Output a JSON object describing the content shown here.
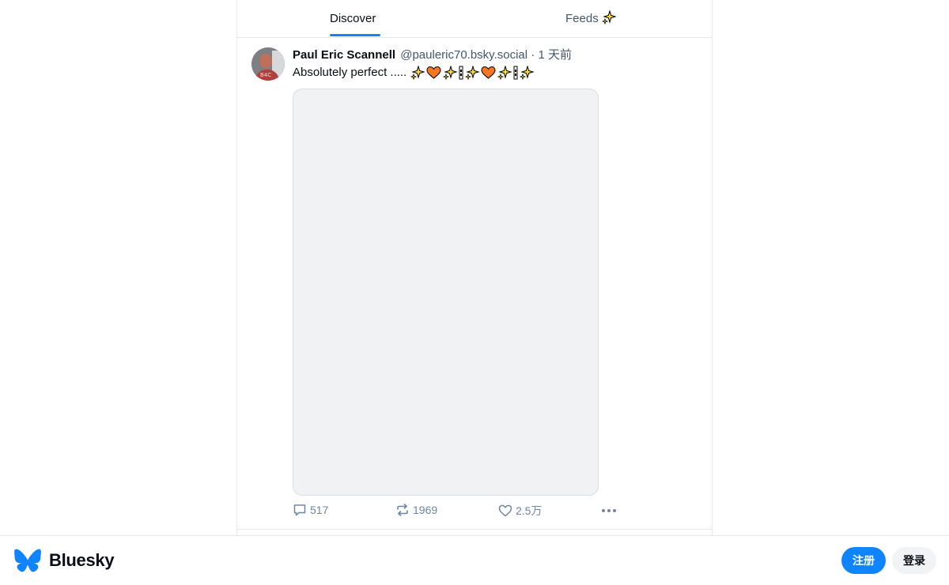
{
  "tabs": {
    "discover": "Discover",
    "feeds": "Feeds"
  },
  "post": {
    "author_name": "Paul Eric Scannell",
    "handle": "@pauleric70.bsky.social",
    "separator": "·",
    "time": "1 天前",
    "text": "Absolutely perfect .....",
    "emojis": [
      "sparkles",
      "orange-heart",
      "sparkles",
      "pipe",
      "sparkles",
      "orange-heart",
      "sparkles",
      "pipe",
      "sparkles"
    ],
    "replies": "517",
    "reposts": "1969",
    "likes": "2.5万"
  },
  "footer": {
    "brand": "Bluesky",
    "signup_label": "注册",
    "login_label": "登录"
  },
  "colors": {
    "accent": "#1083fe",
    "muted_text": "#42576c",
    "action_icon": "#6f869f",
    "media_bg": "#f1f2f4"
  }
}
